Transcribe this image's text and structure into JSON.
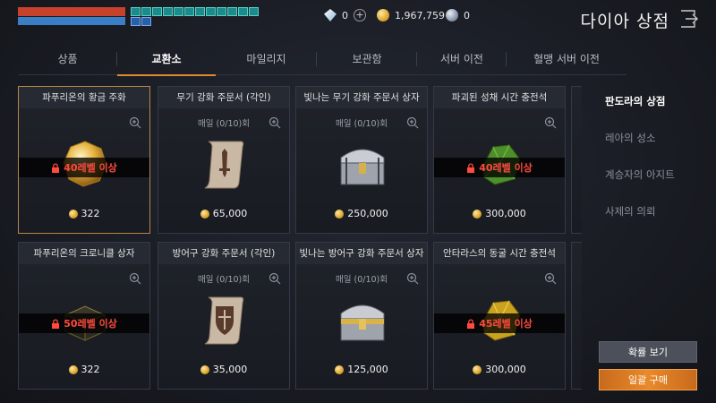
{
  "currency": {
    "diamonds": "0",
    "gold": "1,967,759",
    "moonstone": "0"
  },
  "header": {
    "title": "다이아 상점"
  },
  "tabs": [
    {
      "label": "상품",
      "active": false
    },
    {
      "label": "교환소",
      "active": true
    },
    {
      "label": "마일리지",
      "active": false
    },
    {
      "label": "보관함",
      "active": false
    },
    {
      "label": "서버 이전",
      "active": false
    },
    {
      "label": "혈맹 서버 이전",
      "active": false
    }
  ],
  "items": [
    {
      "title": "파푸리온의 황금 주화",
      "daily": "",
      "lock": "40레벨 이상",
      "price": "322",
      "art": "gold-coin"
    },
    {
      "title": "무기 강화 주문서 (각인)",
      "daily": "매일 (0/10)회",
      "lock": "",
      "price": "65,000",
      "art": "weapon-scroll"
    },
    {
      "title": "빛나는 무기 강화 주문서 상자",
      "daily": "매일 (0/10)회",
      "lock": "",
      "price": "250,000",
      "art": "silver-chest"
    },
    {
      "title": "파괴된 성채 시간 충전석",
      "daily": "",
      "lock": "40레벨 이상",
      "price": "300,000",
      "art": "green-stone"
    },
    {
      "title": "파푸리온의 크로니클 상자",
      "daily": "",
      "lock": "50레벨 이상",
      "price": "322",
      "art": "dark-chest"
    },
    {
      "title": "방어구 강화 주문서 (각인)",
      "daily": "매일 (0/10)회",
      "lock": "",
      "price": "35,000",
      "art": "armor-scroll"
    },
    {
      "title": "빛나는 방어구 강화 주문서 상자",
      "daily": "매일 (0/10)회",
      "lock": "",
      "price": "125,000",
      "art": "gold-chest"
    },
    {
      "title": "안타라스의 동굴 시간 충전석",
      "daily": "",
      "lock": "45레벨 이상",
      "price": "300,000",
      "art": "yellow-stone"
    }
  ],
  "side_menu": [
    {
      "label": "판도라의 상점",
      "active": true
    },
    {
      "label": "레아의 성소",
      "active": false
    },
    {
      "label": "계승자의 아지트",
      "active": false
    },
    {
      "label": "사제의 의뢰",
      "active": false
    }
  ],
  "buttons": {
    "probability": "확률 보기",
    "bulk_buy": "일괄 구매"
  }
}
